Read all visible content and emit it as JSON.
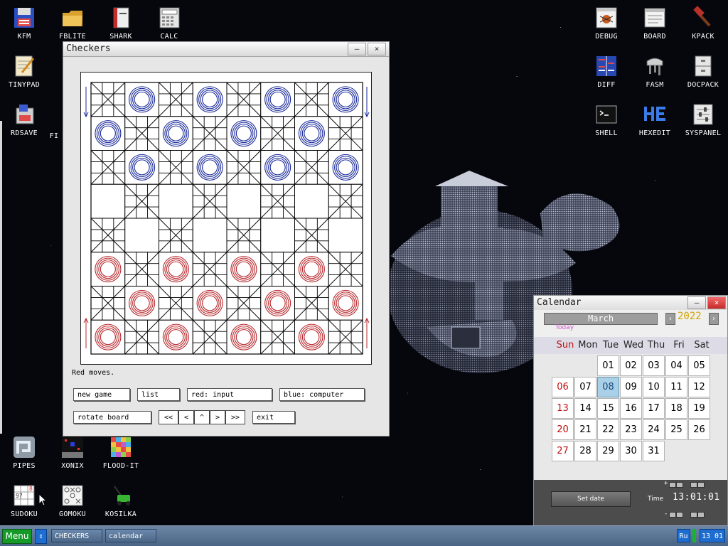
{
  "desktop": {
    "left_icons": [
      {
        "label": "KFM",
        "icon": "floppy-icon"
      },
      {
        "label": "FBLITE",
        "icon": "folder-icon"
      },
      {
        "label": "SHARK",
        "icon": "book-icon"
      },
      {
        "label": "CALC",
        "icon": "calculator-icon"
      },
      {
        "label": "TINYPAD",
        "icon": "notepad-icon"
      },
      {
        "label": "RDSAVE",
        "icon": "rdsave-icon"
      },
      {
        "label": "FI",
        "icon": "fi-icon"
      }
    ],
    "right_icons": [
      {
        "label": "DEBUG",
        "icon": "bug-icon"
      },
      {
        "label": "BOARD",
        "icon": "board-icon"
      },
      {
        "label": "KPACK",
        "icon": "hammer-icon"
      },
      {
        "label": "DIFF",
        "icon": "diff-icon"
      },
      {
        "label": "FASM",
        "icon": "fasm-icon"
      },
      {
        "label": "DOCPACK",
        "icon": "cabinet-icon"
      },
      {
        "label": "SHELL",
        "icon": "terminal-icon"
      },
      {
        "label": "HEXEDIT",
        "icon": "hexedit-icon"
      },
      {
        "label": "SYSPANEL",
        "icon": "sliders-icon"
      }
    ],
    "bottom_icons": [
      {
        "label": "PIPES",
        "icon": "pipes-icon"
      },
      {
        "label": "XONIX",
        "icon": "xonix-icon"
      },
      {
        "label": "FLOOD-IT",
        "icon": "flood-it-icon"
      },
      {
        "label": "SUDOKU",
        "icon": "sudoku-icon"
      },
      {
        "label": "GOMOKU",
        "icon": "gomoku-icon"
      },
      {
        "label": "KOSILKA",
        "icon": "lawnmower-icon"
      }
    ]
  },
  "checkers": {
    "title": "Checkers",
    "minimize": "—",
    "close": "×",
    "status": "Red moves.",
    "buttons": {
      "new_game": "new game",
      "list": "list",
      "red": "red: input",
      "blue": "blue: computer",
      "rotate": "rotate board",
      "first": "<<",
      "prev": "<",
      "up": "^",
      "next": ">",
      "last": ">>",
      "exit": "exit"
    },
    "colors": {
      "blue": "#1a2a9a",
      "red": "#b8282c"
    }
  },
  "calendar": {
    "title": "Calendar",
    "minimize": "—",
    "close": "×",
    "month": "March",
    "year": "2022",
    "today_label": "Today",
    "weekdays": [
      "Sun",
      "Mon",
      "Tue",
      "Wed",
      "Thu",
      "Fri",
      "Sat"
    ],
    "weeks": [
      [
        "",
        "",
        "01",
        "02",
        "03",
        "04",
        "05"
      ],
      [
        "06",
        "07",
        "08",
        "09",
        "10",
        "11",
        "12"
      ],
      [
        "13",
        "14",
        "15",
        "16",
        "17",
        "18",
        "19"
      ],
      [
        "20",
        "21",
        "22",
        "23",
        "24",
        "25",
        "26"
      ],
      [
        "27",
        "28",
        "29",
        "30",
        "31",
        "",
        ""
      ]
    ],
    "selected_day": "08",
    "set_date": "Set date",
    "time_label": "Time",
    "time": "13:01:01",
    "plus": "+",
    "minus": "-"
  },
  "taskbar": {
    "menu": "Menu",
    "swap": "⇕",
    "tasks": [
      "CHECKERS",
      "calendar"
    ],
    "lang": "Ru",
    "clock": "13 01"
  }
}
